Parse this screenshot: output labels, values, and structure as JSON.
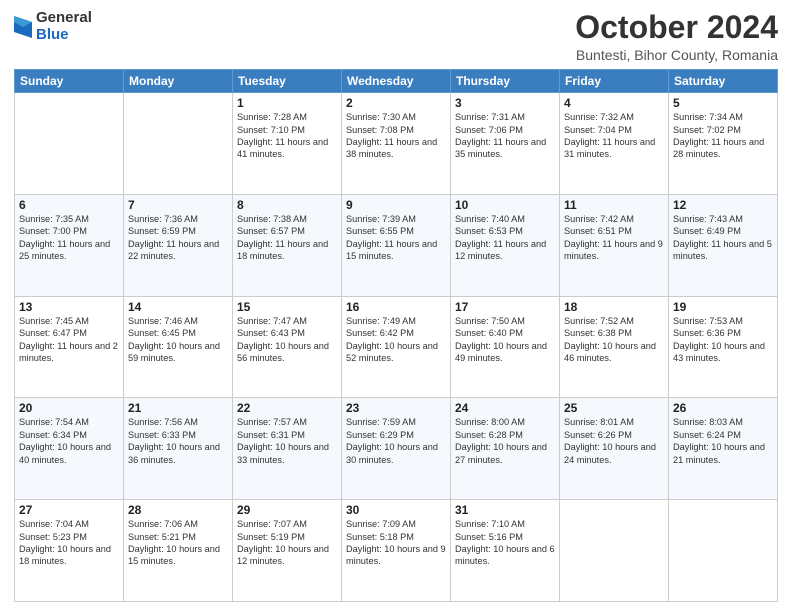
{
  "header": {
    "logo_general": "General",
    "logo_blue": "Blue",
    "title": "October 2024",
    "subtitle": "Buntesti, Bihor County, Romania"
  },
  "days_of_week": [
    "Sunday",
    "Monday",
    "Tuesday",
    "Wednesday",
    "Thursday",
    "Friday",
    "Saturday"
  ],
  "weeks": [
    [
      {
        "day": "",
        "info": ""
      },
      {
        "day": "",
        "info": ""
      },
      {
        "day": "1",
        "info": "Sunrise: 7:28 AM\nSunset: 7:10 PM\nDaylight: 11 hours and 41 minutes."
      },
      {
        "day": "2",
        "info": "Sunrise: 7:30 AM\nSunset: 7:08 PM\nDaylight: 11 hours and 38 minutes."
      },
      {
        "day": "3",
        "info": "Sunrise: 7:31 AM\nSunset: 7:06 PM\nDaylight: 11 hours and 35 minutes."
      },
      {
        "day": "4",
        "info": "Sunrise: 7:32 AM\nSunset: 7:04 PM\nDaylight: 11 hours and 31 minutes."
      },
      {
        "day": "5",
        "info": "Sunrise: 7:34 AM\nSunset: 7:02 PM\nDaylight: 11 hours and 28 minutes."
      }
    ],
    [
      {
        "day": "6",
        "info": "Sunrise: 7:35 AM\nSunset: 7:00 PM\nDaylight: 11 hours and 25 minutes."
      },
      {
        "day": "7",
        "info": "Sunrise: 7:36 AM\nSunset: 6:59 PM\nDaylight: 11 hours and 22 minutes."
      },
      {
        "day": "8",
        "info": "Sunrise: 7:38 AM\nSunset: 6:57 PM\nDaylight: 11 hours and 18 minutes."
      },
      {
        "day": "9",
        "info": "Sunrise: 7:39 AM\nSunset: 6:55 PM\nDaylight: 11 hours and 15 minutes."
      },
      {
        "day": "10",
        "info": "Sunrise: 7:40 AM\nSunset: 6:53 PM\nDaylight: 11 hours and 12 minutes."
      },
      {
        "day": "11",
        "info": "Sunrise: 7:42 AM\nSunset: 6:51 PM\nDaylight: 11 hours and 9 minutes."
      },
      {
        "day": "12",
        "info": "Sunrise: 7:43 AM\nSunset: 6:49 PM\nDaylight: 11 hours and 5 minutes."
      }
    ],
    [
      {
        "day": "13",
        "info": "Sunrise: 7:45 AM\nSunset: 6:47 PM\nDaylight: 11 hours and 2 minutes."
      },
      {
        "day": "14",
        "info": "Sunrise: 7:46 AM\nSunset: 6:45 PM\nDaylight: 10 hours and 59 minutes."
      },
      {
        "day": "15",
        "info": "Sunrise: 7:47 AM\nSunset: 6:43 PM\nDaylight: 10 hours and 56 minutes."
      },
      {
        "day": "16",
        "info": "Sunrise: 7:49 AM\nSunset: 6:42 PM\nDaylight: 10 hours and 52 minutes."
      },
      {
        "day": "17",
        "info": "Sunrise: 7:50 AM\nSunset: 6:40 PM\nDaylight: 10 hours and 49 minutes."
      },
      {
        "day": "18",
        "info": "Sunrise: 7:52 AM\nSunset: 6:38 PM\nDaylight: 10 hours and 46 minutes."
      },
      {
        "day": "19",
        "info": "Sunrise: 7:53 AM\nSunset: 6:36 PM\nDaylight: 10 hours and 43 minutes."
      }
    ],
    [
      {
        "day": "20",
        "info": "Sunrise: 7:54 AM\nSunset: 6:34 PM\nDaylight: 10 hours and 40 minutes."
      },
      {
        "day": "21",
        "info": "Sunrise: 7:56 AM\nSunset: 6:33 PM\nDaylight: 10 hours and 36 minutes."
      },
      {
        "day": "22",
        "info": "Sunrise: 7:57 AM\nSunset: 6:31 PM\nDaylight: 10 hours and 33 minutes."
      },
      {
        "day": "23",
        "info": "Sunrise: 7:59 AM\nSunset: 6:29 PM\nDaylight: 10 hours and 30 minutes."
      },
      {
        "day": "24",
        "info": "Sunrise: 8:00 AM\nSunset: 6:28 PM\nDaylight: 10 hours and 27 minutes."
      },
      {
        "day": "25",
        "info": "Sunrise: 8:01 AM\nSunset: 6:26 PM\nDaylight: 10 hours and 24 minutes."
      },
      {
        "day": "26",
        "info": "Sunrise: 8:03 AM\nSunset: 6:24 PM\nDaylight: 10 hours and 21 minutes."
      }
    ],
    [
      {
        "day": "27",
        "info": "Sunrise: 7:04 AM\nSunset: 5:23 PM\nDaylight: 10 hours and 18 minutes."
      },
      {
        "day": "28",
        "info": "Sunrise: 7:06 AM\nSunset: 5:21 PM\nDaylight: 10 hours and 15 minutes."
      },
      {
        "day": "29",
        "info": "Sunrise: 7:07 AM\nSunset: 5:19 PM\nDaylight: 10 hours and 12 minutes."
      },
      {
        "day": "30",
        "info": "Sunrise: 7:09 AM\nSunset: 5:18 PM\nDaylight: 10 hours and 9 minutes."
      },
      {
        "day": "31",
        "info": "Sunrise: 7:10 AM\nSunset: 5:16 PM\nDaylight: 10 hours and 6 minutes."
      },
      {
        "day": "",
        "info": ""
      },
      {
        "day": "",
        "info": ""
      }
    ]
  ]
}
